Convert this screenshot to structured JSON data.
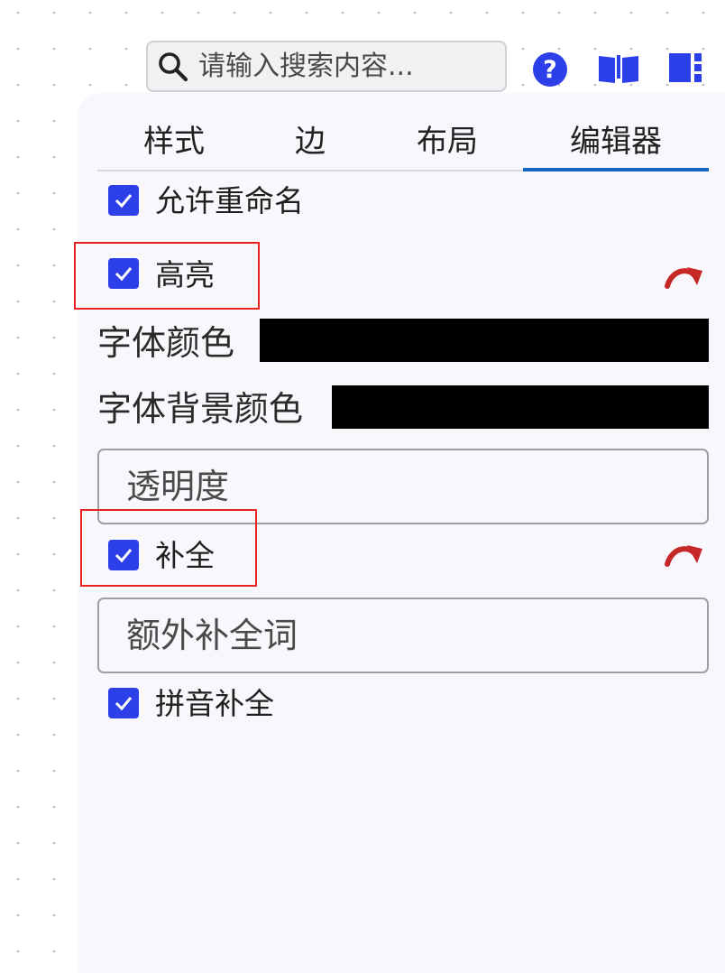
{
  "search": {
    "placeholder": "请输入搜索内容..."
  },
  "toolbar": {
    "help_icon": "question-circle-icon",
    "docs_icon": "open-book-icon",
    "layout_icon": "panel-layout-icon",
    "accent_color": "#2d3fe8"
  },
  "tabs": [
    {
      "label": "样式",
      "active": false
    },
    {
      "label": "边",
      "active": false
    },
    {
      "label": "布局",
      "active": false
    },
    {
      "label": "编辑器",
      "active": true
    }
  ],
  "editor": {
    "allow_rename": {
      "label": "允许重命名",
      "checked": true
    },
    "highlight": {
      "label": "高亮",
      "checked": true
    },
    "font_color": {
      "label": "字体颜色",
      "value": "#000000"
    },
    "font_bg_color": {
      "label": "字体背景颜色",
      "value": "#000000"
    },
    "opacity": {
      "placeholder": "透明度"
    },
    "completion": {
      "label": "补全",
      "checked": true
    },
    "extra_words": {
      "placeholder": "额外补全词"
    },
    "pinyin": {
      "label": "拼音补全",
      "checked": true
    }
  },
  "colors": {
    "panel_bg": "#f8f8fc",
    "tab_underline": "#1565c0",
    "checkbox": "#2d3fe8",
    "reset_icon": "#c62828",
    "highlight_box": "#ea2323"
  }
}
